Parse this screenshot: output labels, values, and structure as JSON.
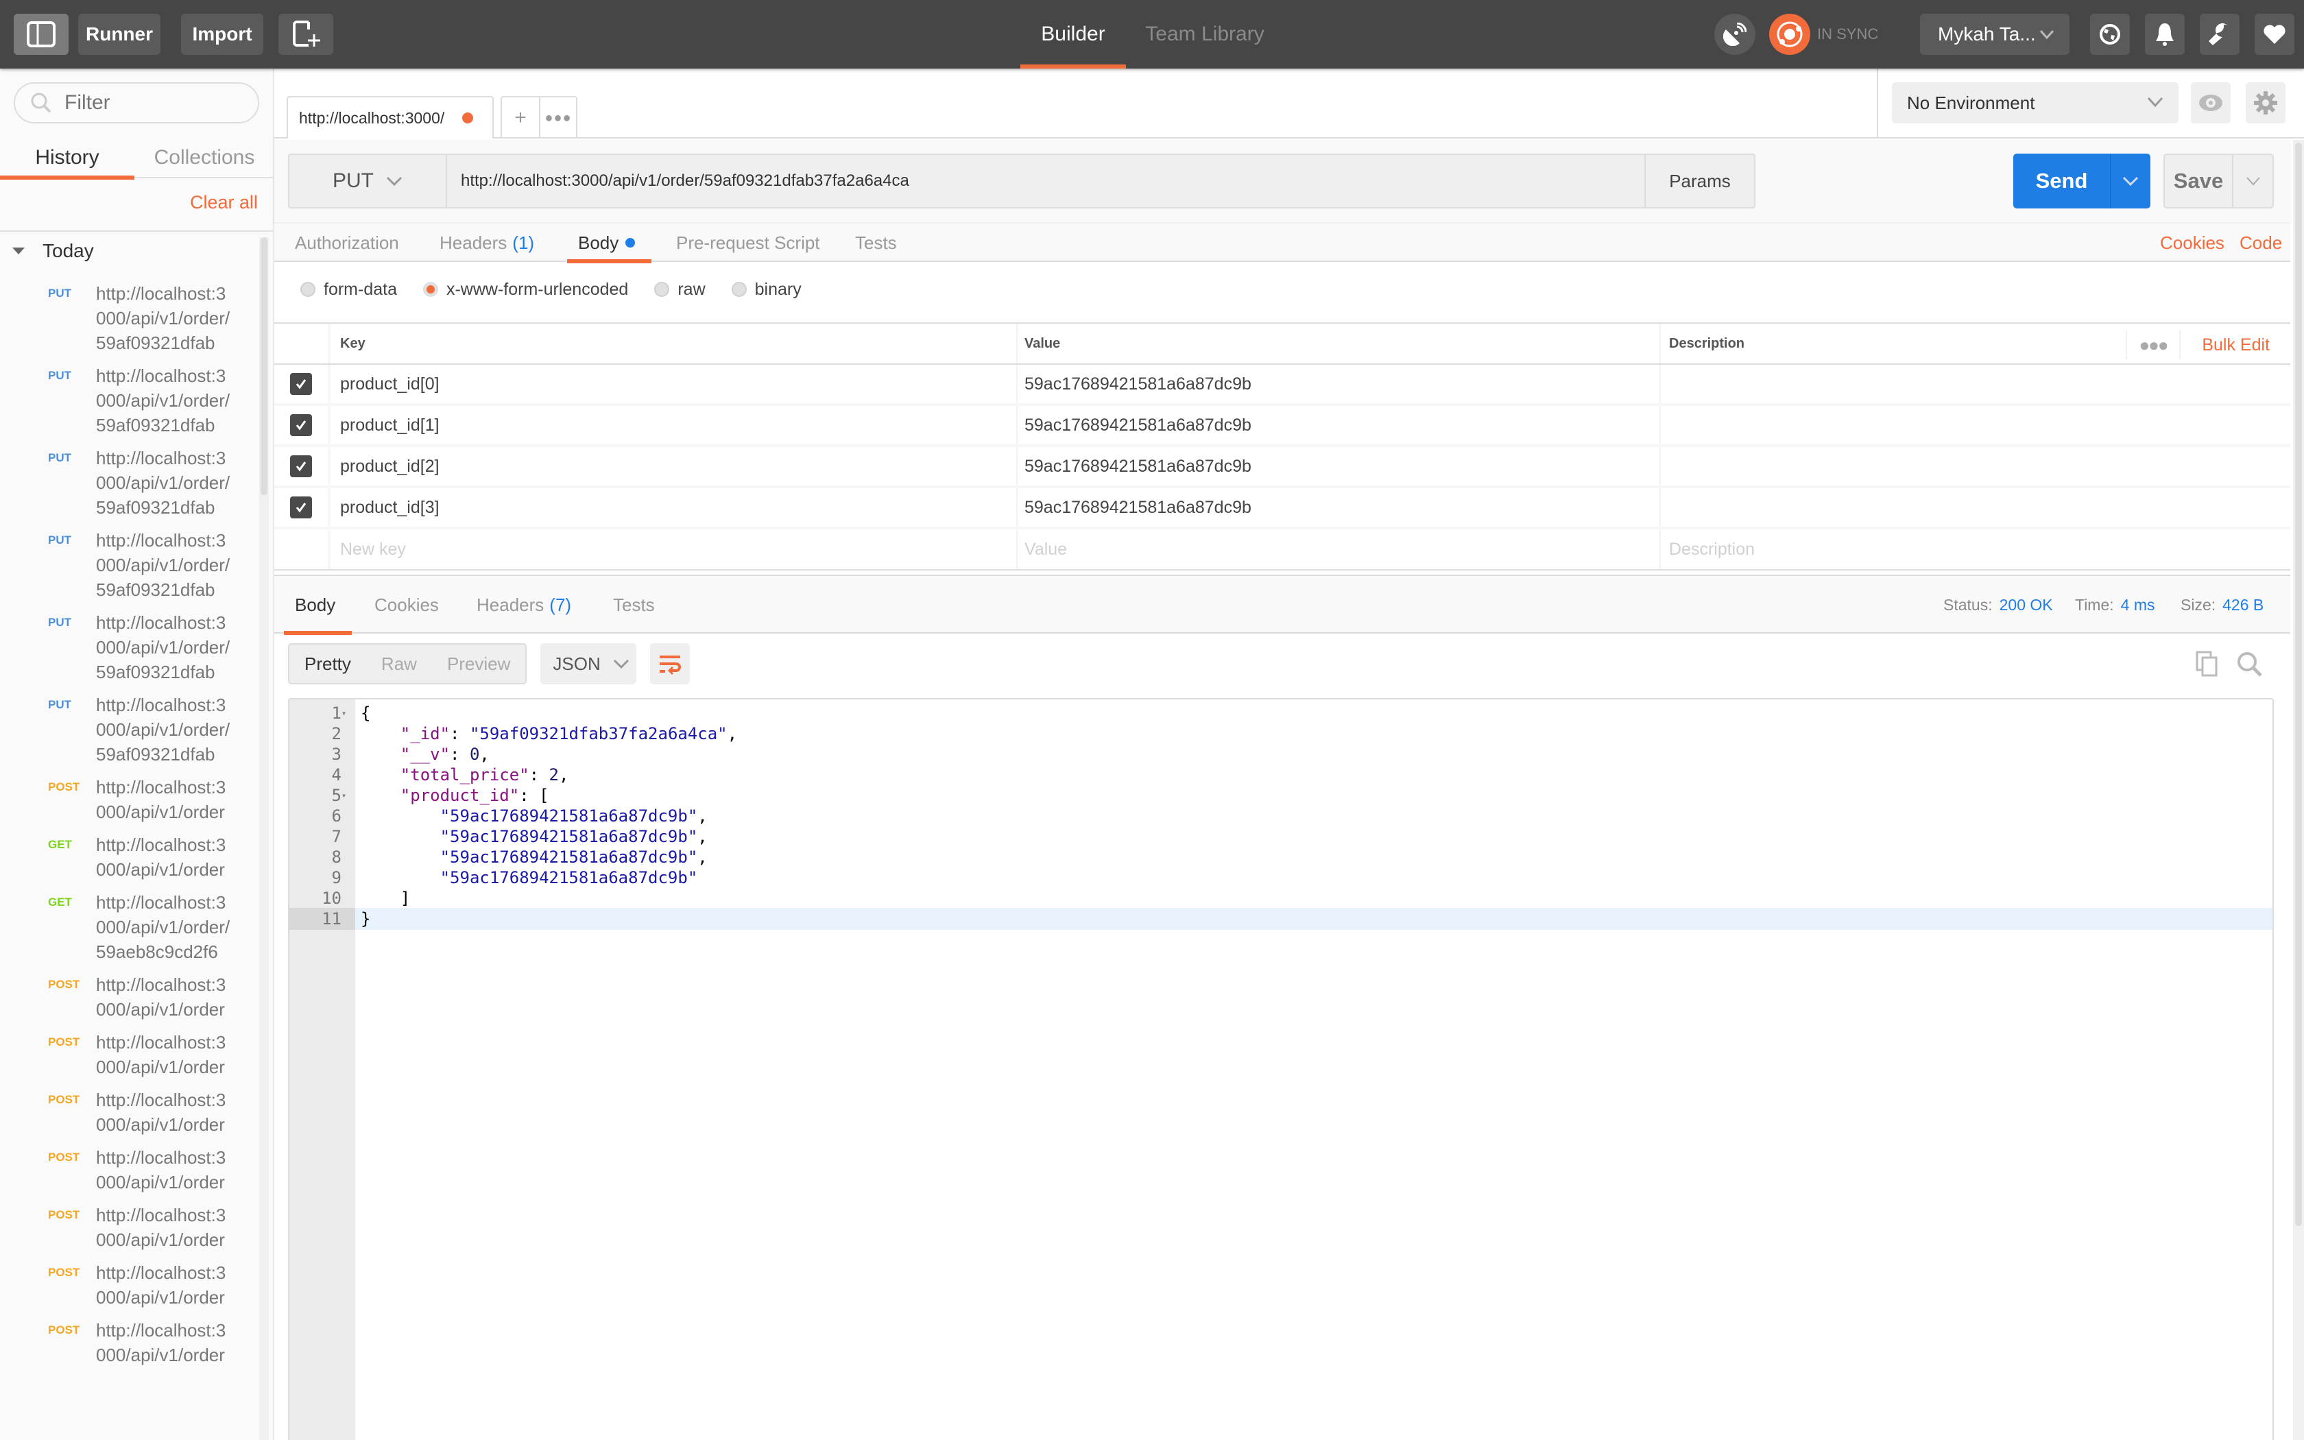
{
  "topbar": {
    "runner_label": "Runner",
    "import_label": "Import",
    "nav_tabs": [
      {
        "label": "Builder",
        "active": true
      },
      {
        "label": "Team Library",
        "active": false
      }
    ],
    "sync_status": "IN SYNC",
    "user_name": "Mykah Ta...",
    "icons": [
      "sidebar-toggle-icon",
      "new-window-icon",
      "interceptor-icon",
      "sync-icon",
      "globe-icon",
      "bell-icon",
      "wrench-icon",
      "heart-icon"
    ]
  },
  "sidebar": {
    "filter_placeholder": "Filter",
    "tabs": [
      {
        "label": "History",
        "active": true
      },
      {
        "label": "Collections",
        "active": false
      }
    ],
    "clear_all_label": "Clear all",
    "group_label": "Today",
    "history": [
      {
        "method": "PUT",
        "url": "http://localhost:3000/api/v1/order/59af09321dfab"
      },
      {
        "method": "PUT",
        "url": "http://localhost:3000/api/v1/order/59af09321dfab"
      },
      {
        "method": "PUT",
        "url": "http://localhost:3000/api/v1/order/59af09321dfab"
      },
      {
        "method": "PUT",
        "url": "http://localhost:3000/api/v1/order/59af09321dfab"
      },
      {
        "method": "PUT",
        "url": "http://localhost:3000/api/v1/order/59af09321dfab"
      },
      {
        "method": "PUT",
        "url": "http://localhost:3000/api/v1/order/59af09321dfab"
      },
      {
        "method": "POST",
        "url": "http://localhost:3000/api/v1/order"
      },
      {
        "method": "GET",
        "url": "http://localhost:3000/api/v1/order"
      },
      {
        "method": "GET",
        "url": "http://localhost:3000/api/v1/order/59aeb8c9cd2f6"
      },
      {
        "method": "POST",
        "url": "http://localhost:3000/api/v1/order"
      },
      {
        "method": "POST",
        "url": "http://localhost:3000/api/v1/order"
      },
      {
        "method": "POST",
        "url": "http://localhost:3000/api/v1/order"
      },
      {
        "method": "POST",
        "url": "http://localhost:3000/api/v1/order"
      },
      {
        "method": "POST",
        "url": "http://localhost:3000/api/v1/order"
      },
      {
        "method": "POST",
        "url": "http://localhost:3000/api/v1/order"
      },
      {
        "method": "POST",
        "url": "http://localhost:3000/api/v1/order"
      }
    ]
  },
  "colors": {
    "accent": "#f26b3a",
    "send_blue": "#1f7de6",
    "method_put": "#4a90d9",
    "method_post": "#f5a623",
    "method_get": "#7ed321",
    "topbar_bg": "#464646"
  },
  "request_tab": {
    "title": "http://localhost:3000/",
    "unsaved": true
  },
  "environment": {
    "selected": "No Environment"
  },
  "request": {
    "method": "PUT",
    "url": "http://localhost:3000/api/v1/order/59af09321dfab37fa2a6a4ca",
    "params_label": "Params",
    "send_label": "Send",
    "save_label": "Save",
    "tabs": [
      {
        "label": "Authorization",
        "count": ""
      },
      {
        "label": "Headers",
        "count": "(1)"
      },
      {
        "label": "Body",
        "count": "",
        "active": true
      },
      {
        "label": "Pre-request Script",
        "count": ""
      },
      {
        "label": "Tests",
        "count": ""
      }
    ],
    "cookies_label": "Cookies",
    "code_label": "Code",
    "body_types": [
      {
        "label": "form-data",
        "selected": false
      },
      {
        "label": "x-www-form-urlencoded",
        "selected": true
      },
      {
        "label": "raw",
        "selected": false
      },
      {
        "label": "binary",
        "selected": false
      }
    ],
    "table": {
      "headers": {
        "key": "Key",
        "value": "Value",
        "description": "Description"
      },
      "bulk_edit_label": "Bulk Edit",
      "rows": [
        {
          "checked": true,
          "key": "product_id[0]",
          "value": "59ac17689421581a6a87dc9b",
          "description": ""
        },
        {
          "checked": true,
          "key": "product_id[1]",
          "value": "59ac17689421581a6a87dc9b",
          "description": ""
        },
        {
          "checked": true,
          "key": "product_id[2]",
          "value": "59ac17689421581a6a87dc9b",
          "description": ""
        },
        {
          "checked": true,
          "key": "product_id[3]",
          "value": "59ac17689421581a6a87dc9b",
          "description": ""
        }
      ],
      "new_row": {
        "key_placeholder": "New key",
        "value_placeholder": "Value",
        "description_placeholder": "Description"
      }
    }
  },
  "response": {
    "tabs": [
      {
        "label": "Body",
        "count": "",
        "active": true
      },
      {
        "label": "Cookies",
        "count": ""
      },
      {
        "label": "Headers",
        "count": "(7)"
      },
      {
        "label": "Tests",
        "count": ""
      }
    ],
    "status_label": "Status:",
    "status": "200 OK",
    "time_label": "Time:",
    "time": "4 ms",
    "size_label": "Size:",
    "size": "426 B",
    "view_modes": [
      "Pretty",
      "Raw",
      "Preview"
    ],
    "active_view": "Pretty",
    "format": "JSON",
    "body_lines": [
      {
        "n": "1",
        "fold": true,
        "parts": [
          [
            "p",
            "{"
          ]
        ]
      },
      {
        "n": "2",
        "parts": [
          [
            "p",
            "    "
          ],
          [
            "k",
            "\"_id\""
          ],
          [
            "p",
            ": "
          ],
          [
            "s",
            "\"59af09321dfab37fa2a6a4ca\""
          ],
          [
            "p",
            ","
          ]
        ]
      },
      {
        "n": "3",
        "parts": [
          [
            "p",
            "    "
          ],
          [
            "k",
            "\"__v\""
          ],
          [
            "p",
            ": "
          ],
          [
            "n",
            "0"
          ],
          [
            "p",
            ","
          ]
        ]
      },
      {
        "n": "4",
        "parts": [
          [
            "p",
            "    "
          ],
          [
            "k",
            "\"total_price\""
          ],
          [
            "p",
            ": "
          ],
          [
            "n",
            "2"
          ],
          [
            "p",
            ","
          ]
        ]
      },
      {
        "n": "5",
        "fold": true,
        "parts": [
          [
            "p",
            "    "
          ],
          [
            "k",
            "\"product_id\""
          ],
          [
            "p",
            ": ["
          ]
        ]
      },
      {
        "n": "6",
        "parts": [
          [
            "p",
            "        "
          ],
          [
            "s",
            "\"59ac17689421581a6a87dc9b\""
          ],
          [
            "p",
            ","
          ]
        ]
      },
      {
        "n": "7",
        "parts": [
          [
            "p",
            "        "
          ],
          [
            "s",
            "\"59ac17689421581a6a87dc9b\""
          ],
          [
            "p",
            ","
          ]
        ]
      },
      {
        "n": "8",
        "parts": [
          [
            "p",
            "        "
          ],
          [
            "s",
            "\"59ac17689421581a6a87dc9b\""
          ],
          [
            "p",
            ","
          ]
        ]
      },
      {
        "n": "9",
        "parts": [
          [
            "p",
            "        "
          ],
          [
            "s",
            "\"59ac17689421581a6a87dc9b\""
          ]
        ]
      },
      {
        "n": "10",
        "parts": [
          [
            "p",
            "    ]"
          ]
        ]
      },
      {
        "n": "11",
        "current": true,
        "parts": [
          [
            "p",
            "}"
          ]
        ]
      }
    ]
  }
}
